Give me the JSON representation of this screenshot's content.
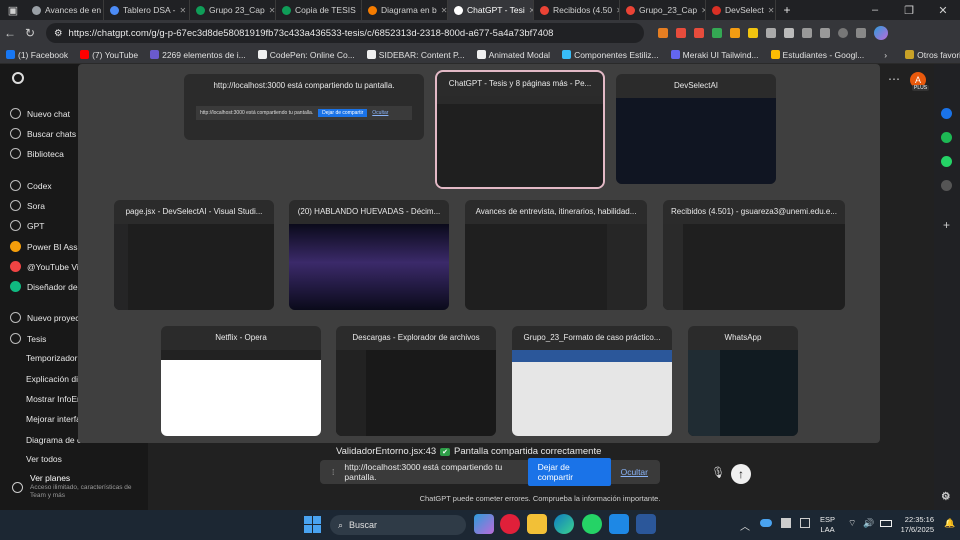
{
  "browser": {
    "tabs": [
      {
        "label": "Avances de en",
        "color": "#9aa0a6"
      },
      {
        "label": "Tablero DSA -",
        "color": "#4c8bf5"
      },
      {
        "label": "Grupo 23_Cap",
        "color": "#0f9d58"
      },
      {
        "label": "Copia de TESIS",
        "color": "#0f9d58"
      },
      {
        "label": "Diagrama en b",
        "color": "#f57c00"
      },
      {
        "label": "ChatGPT - Tesi",
        "color": "#ffffff",
        "active": true
      },
      {
        "label": "Recibidos (4.50",
        "color": "#ea4335"
      },
      {
        "label": "Grupo_23_Cap",
        "color": "#ea4335"
      },
      {
        "label": "DevSelect",
        "color": "#d93025"
      }
    ],
    "url": "https://chatgpt.com/g/g-p-67ec3d8de58081919fb73c433a436533-tesis/c/6852313d-2318-800d-a677-5a4a73bf7408",
    "bookmarks": [
      {
        "label": "(1) Facebook",
        "color": "#1877f2"
      },
      {
        "label": "(7) YouTube",
        "color": "#ff0000"
      },
      {
        "label": "2269 elementos de i...",
        "color": "#6a5acd"
      },
      {
        "label": "CodePen: Online Co...",
        "color": "#f0f0f0"
      },
      {
        "label": "SIDEBAR: Content P...",
        "color": "#f0f0f0"
      },
      {
        "label": "Animated Modal",
        "color": "#f0f0f0"
      },
      {
        "label": "Componentes Estiliz...",
        "color": "#38bdf8"
      },
      {
        "label": "Meraki UI Tailwind...",
        "color": "#6366f1"
      },
      {
        "label": "Estudiantes - Googl...",
        "color": "#fbbc04"
      }
    ],
    "other_favorites": "Otros favoritos"
  },
  "sidebar": {
    "items": [
      {
        "label": "Nuevo chat",
        "icon": "edit-icon"
      },
      {
        "label": "Buscar chats",
        "icon": "search-icon"
      },
      {
        "label": "Biblioteca",
        "icon": "library-icon"
      },
      {
        "label": "Codex",
        "icon": "codex-icon"
      },
      {
        "label": "Sora",
        "icon": "sora-icon"
      },
      {
        "label": "GPT",
        "icon": "gpt-icon"
      },
      {
        "label": "Power BI Assist",
        "icon": "gpt-avatar-icon"
      },
      {
        "label": "@YouTube Vid",
        "icon": "gpt-avatar-icon"
      },
      {
        "label": "Diseñador de l",
        "icon": "gpt-avatar-icon"
      },
      {
        "label": "Nuevo proyect",
        "icon": "folder-icon"
      },
      {
        "label": "Tesis",
        "icon": "folder-icon"
      },
      {
        "label": "Temporizador I",
        "icon": ""
      },
      {
        "label": "Explicación dia",
        "icon": ""
      },
      {
        "label": "Mostrar InfoEn",
        "icon": ""
      },
      {
        "label": "Mejorar interfa",
        "icon": ""
      },
      {
        "label": "Diagrama de c",
        "icon": ""
      },
      {
        "label": "Ver todos",
        "icon": ""
      }
    ],
    "plans_title": "Ver planes",
    "plans_sub": "Acceso ilimitado, características de Team y más"
  },
  "picker": {
    "cards": [
      {
        "title": "http://localhost:3000 está compartiendo tu pantalla.",
        "kind": "share"
      },
      {
        "title": "ChatGPT - Tesis y 8 páginas más - Pe...",
        "kind": "chat",
        "selected": true
      },
      {
        "title": "DevSelectAI",
        "kind": "devselect"
      },
      {
        "title": "page.jsx - DevSelectAI - Visual Studi...",
        "kind": "code"
      },
      {
        "title": "(20) HABLANDO HUEVADAS - Décim...",
        "kind": "video"
      },
      {
        "title": "Avances de entrevista, itinerarios, habilidad...",
        "kind": "doc"
      },
      {
        "title": "Recibidos (4.501) - gsuareza3@unemi.edu.e...",
        "kind": "mail"
      },
      {
        "title": "Netflix - Opera",
        "kind": "light"
      },
      {
        "title": "Descargas - Explorador de archivos",
        "kind": "files"
      },
      {
        "title": "Grupo_23_Formato de caso práctico...",
        "kind": "word"
      },
      {
        "title": "WhatsApp",
        "kind": "whatsapp"
      }
    ],
    "share_mini_text": "http://localhost:3000 está compartiendo tu pantalla.",
    "share_mini_btn": "Dejar de compartir",
    "share_mini_hide": "Ocultar"
  },
  "chat": {
    "log_line": "ValidadorEntorno.jsx:43",
    "log_msg": "Pantalla compartida correctamente",
    "toast_text": "http://localhost:3000 está compartiendo tu pantalla.",
    "stop_label": "Dejar de compartir",
    "hide_label": "Ocultar",
    "disclaimer": "ChatGPT puede cometer errores. Comprueba la información importante."
  },
  "user": {
    "avatar_letter": "A",
    "badge": "PLUS"
  },
  "taskbar": {
    "search_placeholder": "Buscar",
    "lang": "ESP",
    "lang2": "LAA",
    "time": "22:35:16",
    "date": "17/6/2025"
  }
}
